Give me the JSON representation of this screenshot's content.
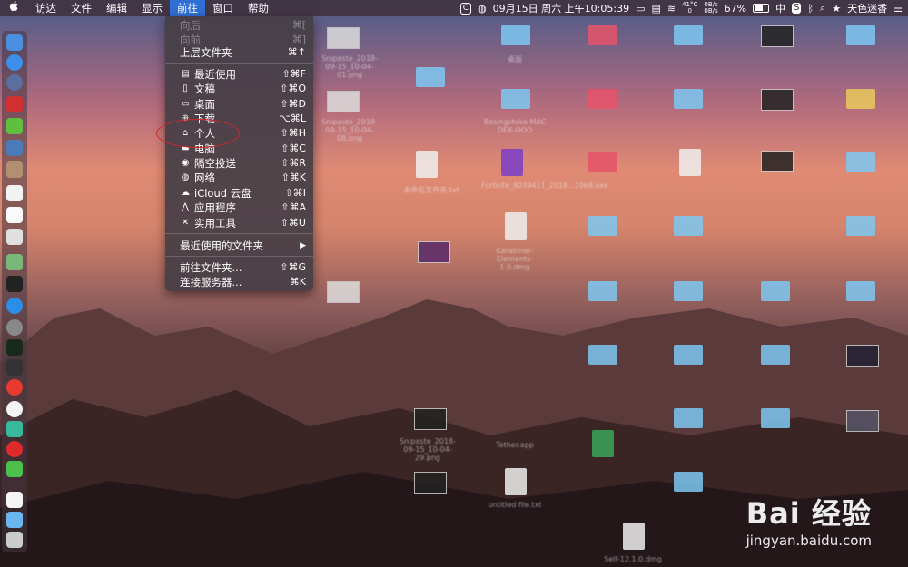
{
  "menubar": {
    "apple": "",
    "items": [
      "访达",
      "文件",
      "编辑",
      "显示",
      "前往",
      "窗口",
      "帮助"
    ],
    "active_index": 4,
    "right": {
      "app_badge": "C",
      "datetime": "09月15日 周六 上午10:05:39",
      "temp_top": "41°C",
      "temp_bottom": "0",
      "net_up": "0B/s",
      "net_down": "0B/s",
      "battery": "67%",
      "input_method": "中",
      "user": "天色迷香"
    }
  },
  "go_menu": {
    "items": [
      {
        "label": "向后",
        "shortcut": "⌘[",
        "disabled": true
      },
      {
        "label": "向前",
        "shortcut": "⌘]",
        "disabled": true
      },
      {
        "label": "上层文件夹",
        "shortcut": "⌘↑"
      },
      {
        "label": "最近使用",
        "shortcut": "⇧⌘F",
        "icon": "recents-icon"
      },
      {
        "label": "文稿",
        "shortcut": "⇧⌘O",
        "icon": "documents-icon"
      },
      {
        "label": "桌面",
        "shortcut": "⇧⌘D",
        "icon": "desktop-icon"
      },
      {
        "label": "下载",
        "shortcut": "⌥⌘L",
        "icon": "downloads-icon"
      },
      {
        "label": "个人",
        "shortcut": "⇧⌘H",
        "icon": "home-icon"
      },
      {
        "label": "电脑",
        "shortcut": "⇧⌘C",
        "icon": "computer-icon"
      },
      {
        "label": "隔空投送",
        "shortcut": "⇧⌘R",
        "icon": "airdrop-icon"
      },
      {
        "label": "网络",
        "shortcut": "⇧⌘K",
        "icon": "network-icon"
      },
      {
        "label": "iCloud 云盘",
        "shortcut": "⇧⌘I",
        "icon": "icloud-icon"
      },
      {
        "label": "应用程序",
        "shortcut": "⇧⌘A",
        "icon": "applications-icon"
      },
      {
        "label": "实用工具",
        "shortcut": "⇧⌘U",
        "icon": "utilities-icon"
      },
      {
        "label": "最近使用的文件夹",
        "shortcut": "▶"
      },
      {
        "label": "前往文件夹...",
        "shortcut": "⇧⌘G"
      },
      {
        "label": "连接服务器...",
        "shortcut": "⌘K"
      }
    ]
  },
  "desktop_captions": {
    "c1": "Snipaste_2018-09-15_10-04-01.png",
    "c2": "Snipaste_2018-09-15_10-04-08.png",
    "c3": "桌面",
    "c4": "Basingstoke MAC DEX-OOO",
    "c5": "Fortnite_8039411_2018...1068.exe",
    "c6": "Karabiner-Elements-1.0.dmg",
    "c7": "未命名文件夹.txt",
    "c8": "Snipaste_2018-09-15_10-04-29.png",
    "c9": "Tether.app",
    "c10": "untitled file.txt",
    "c11": "Self-12.1.0.dmg"
  },
  "watermark": {
    "logo": "Bai 经验",
    "url": "jingyan.baidu.com"
  }
}
